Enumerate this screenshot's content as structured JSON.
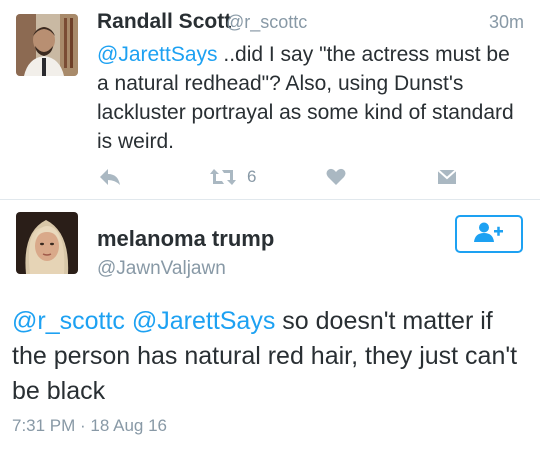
{
  "reply_tweet": {
    "display_name": "Randall Scott",
    "handle": "@r_scottc",
    "time": "30m",
    "mention": "@JarettSays",
    "text": " ..did I say \"the actress must be a natural redhead\"? Also, using Dunst's lackluster portrayal as some kind of standard is weird.",
    "retweet_count": "6",
    "action_icons": [
      "reply-icon",
      "retweet-icon",
      "like-icon",
      "direct-message-icon"
    ],
    "colors": {
      "icon": "#aab8c2",
      "link": "#1da1f2",
      "muted": "#8899a6"
    }
  },
  "main_tweet": {
    "display_name": "melanoma trump",
    "handle": "@JawnValjawn",
    "mentions": [
      "@r_scottc",
      "@JarettSays"
    ],
    "text": " so doesn't matter if the person has natural red hair, they just can't be black",
    "timestamp": "7:31 PM · 18 Aug 16",
    "follow_icon": "follow-user-icon",
    "colors": {
      "accent": "#1da1f2",
      "text": "#292f33"
    }
  }
}
